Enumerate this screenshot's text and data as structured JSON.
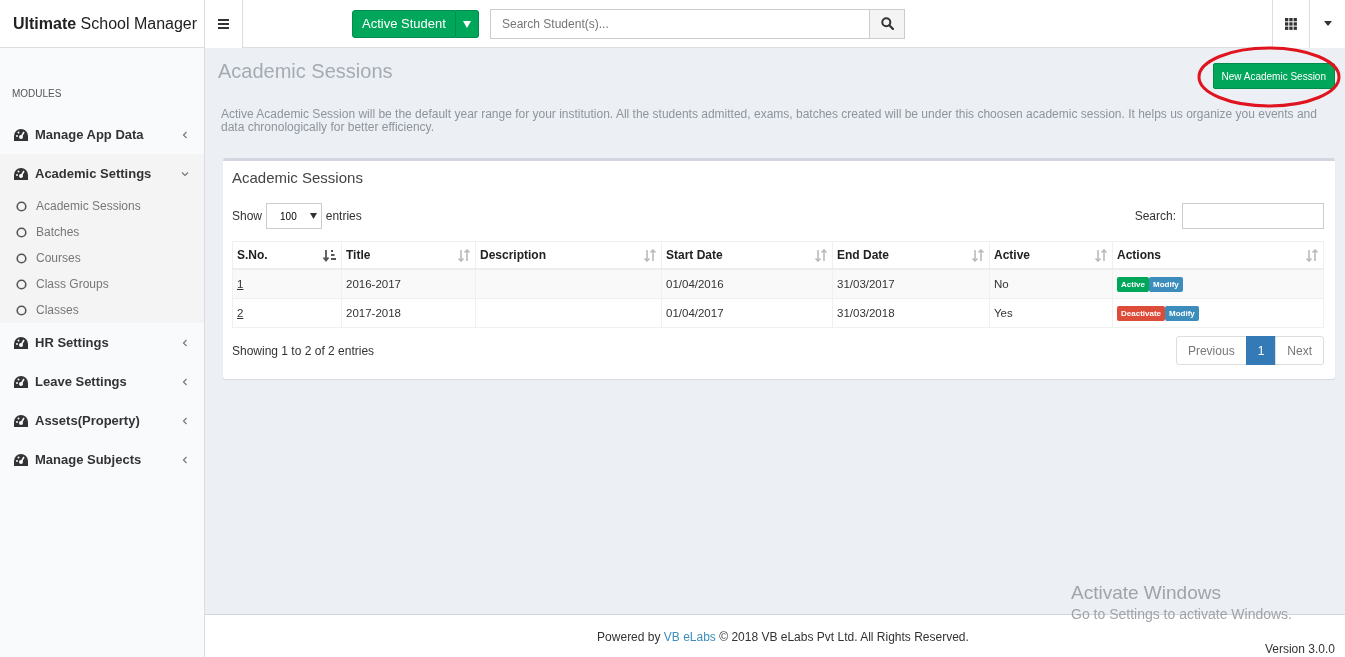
{
  "brand": {
    "bold": "Ultimate",
    "rest": "School Manager"
  },
  "header": {
    "split_button": "Active Student",
    "search": {
      "placeholder": "Search Student(s)..."
    }
  },
  "sidebar": {
    "heading": "MODULES",
    "items": [
      {
        "label": "Manage App Data",
        "expanded": false
      },
      {
        "label": "Academic Settings",
        "expanded": true,
        "children": [
          {
            "label": "Academic Sessions"
          },
          {
            "label": "Batches"
          },
          {
            "label": "Courses"
          },
          {
            "label": "Class Groups"
          },
          {
            "label": "Classes"
          }
        ]
      },
      {
        "label": "HR Settings",
        "expanded": false
      },
      {
        "label": "Leave Settings",
        "expanded": false
      },
      {
        "label": "Assets(Property)",
        "expanded": false
      },
      {
        "label": "Manage Subjects",
        "expanded": false
      }
    ]
  },
  "page": {
    "title": "Academic Sessions",
    "new_button": "New Academic Session",
    "annotation": true,
    "description": "Active Academic Session will be the default year range for your institution. All the students admitted, exams, batches created will be under this choosen academic session. It helps us organize you events and data chronologically for better efficiency."
  },
  "card": {
    "title": "Academic Sessions",
    "show_label": "Show",
    "page_size": "100",
    "entries_label": "entries",
    "search_label": "Search:",
    "columns": [
      {
        "label": "S.No.",
        "sorted": true
      },
      {
        "label": "Title",
        "sorted": false
      },
      {
        "label": "Description",
        "sorted": false
      },
      {
        "label": "Start Date",
        "sorted": false
      },
      {
        "label": "End Date",
        "sorted": false
      },
      {
        "label": "Active",
        "sorted": false
      },
      {
        "label": "Actions",
        "sorted": false
      }
    ],
    "rows": [
      {
        "sno": "1",
        "title": "2016-2017",
        "start": "01/04/2016",
        "end": "31/03/2017",
        "active": "No",
        "actions": [
          {
            "kind": "activate",
            "label": "Active"
          },
          {
            "kind": "modify",
            "label": "Modify"
          }
        ]
      },
      {
        "sno": "2",
        "title": "2017-2018",
        "start": "01/04/2017",
        "end": "31/03/2018",
        "active": "Yes",
        "actions": [
          {
            "kind": "deactivate",
            "label": "Deactivate"
          },
          {
            "kind": "modify",
            "label": "Modify"
          }
        ]
      }
    ],
    "info": "Showing 1 to 2 of 2 entries",
    "previous": "Previous",
    "pages": [
      {
        "label": "1",
        "selected": true
      }
    ],
    "next": "Next"
  },
  "footer": {
    "prefix": "Powered by",
    "link": "VB eLabs",
    "suffix": "© 2018 VB eLabs Pvt Ltd. All Rights Reserved.",
    "version": "Version 3.0.0"
  },
  "os_notice": {
    "title": "Activate Windows",
    "subtitle": "Go to Settings to activate Windows."
  }
}
